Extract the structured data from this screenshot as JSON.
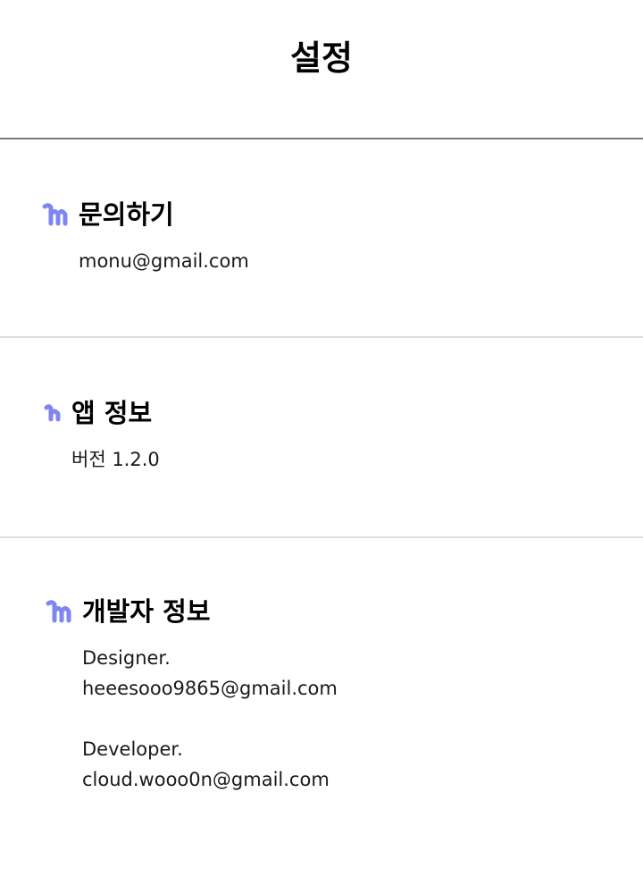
{
  "header": {
    "title": "설정"
  },
  "sections": [
    {
      "title": "문의하기",
      "icon": "mm-logo-icon",
      "lines": [
        "monu@gmail.com"
      ]
    },
    {
      "title": "앱 정보",
      "icon": "m-logo-small-icon",
      "lines": [
        "버전 1.2.0"
      ]
    },
    {
      "title": "개발자 정보",
      "icon": "mm-logo-icon",
      "lines": [
        "Designer.",
        "heeesooo9865@gmail.com",
        "Developer.",
        "cloud.wooo0n@gmail.com"
      ]
    }
  ],
  "colors": {
    "accent": "#7f86f2",
    "text": "#111111",
    "divider": "#dedede",
    "header_rule": "#7a7a7a"
  }
}
